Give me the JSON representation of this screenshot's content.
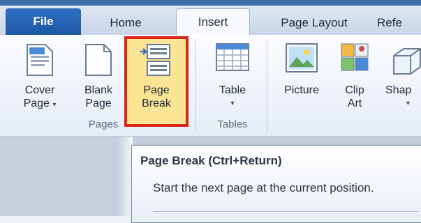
{
  "tabs": {
    "file": "File",
    "home": "Home",
    "insert": "Insert",
    "page_layout": "Page Layout",
    "references": "Refe"
  },
  "ribbon": {
    "groups": {
      "pages": "Pages",
      "tables": "Tables"
    },
    "commands": {
      "cover_page": {
        "line1": "Cover",
        "line2": "Page",
        "arrow": "▾"
      },
      "blank_page": {
        "line1": "Blank",
        "line2": "Page"
      },
      "page_break": {
        "line1": "Page",
        "line2": "Break"
      },
      "table": {
        "line1": "Table",
        "arrow": "▾"
      },
      "picture": {
        "line1": "Picture"
      },
      "clip_art": {
        "line1": "Clip",
        "line2": "Art"
      },
      "shapes": {
        "line1": "Shap",
        "arrow": "▾"
      }
    }
  },
  "tooltip": {
    "title": "Page Break (Ctrl+Return)",
    "description": "Start the next page at the current position."
  },
  "colors": {
    "file_tab": "#1e57a3",
    "highlight_fill": "#fbe594",
    "highlight_border": "#d9261c"
  },
  "icons": {
    "cover_page": "cover-page-icon",
    "blank_page": "blank-page-icon",
    "page_break": "page-break-icon",
    "table": "table-icon",
    "picture": "picture-icon",
    "clip_art": "clip-art-icon",
    "shapes": "shapes-icon"
  }
}
